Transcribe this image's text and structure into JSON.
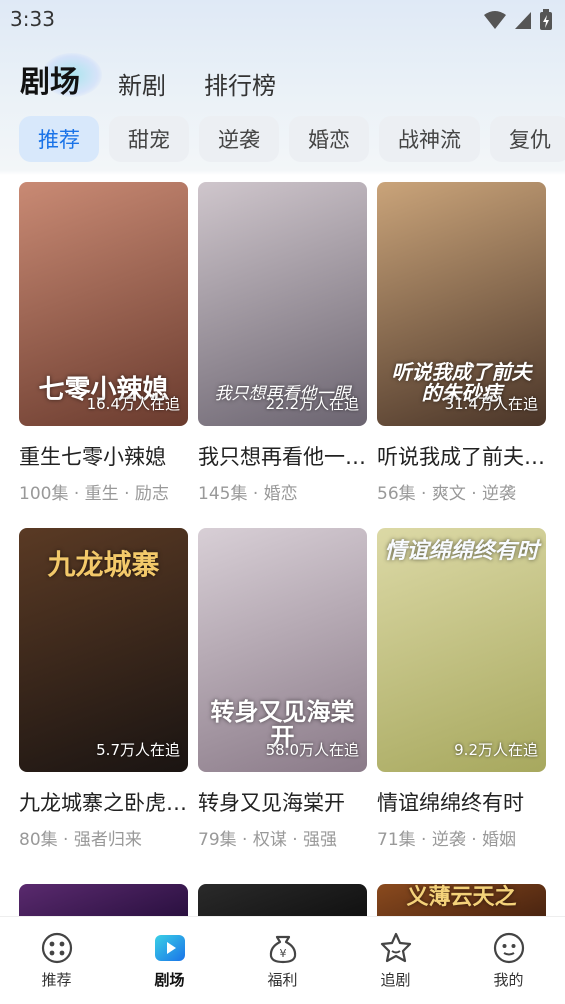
{
  "status_bar": {
    "time": "3:33"
  },
  "header": {
    "tabs": [
      {
        "label": "剧场",
        "active": true
      },
      {
        "label": "新剧",
        "active": false
      },
      {
        "label": "排行榜",
        "active": false
      }
    ]
  },
  "categories": [
    "推荐",
    "甜宠",
    "逆袭",
    "婚恋",
    "战神流",
    "复仇"
  ],
  "dramas": [
    {
      "title": "重生七零小辣媳",
      "poster_text": "七零小辣媳",
      "followers": "16.4万人在追",
      "meta": "100集 · 重生 · 励志",
      "colors": [
        "#c98a74",
        "#6a3b2e"
      ]
    },
    {
      "title": "我只想再看他一…",
      "poster_text": "我只想再看他一眼",
      "followers": "22.2万人在追",
      "meta": "145集 · 婚恋",
      "colors": [
        "#cfc6cc",
        "#6b6470"
      ]
    },
    {
      "title": "听说我成了前夫…",
      "poster_text": "听说我成了前夫的朱砂痣",
      "followers": "31.4万人在追",
      "meta": "56集 · 爽文 · 逆袭",
      "colors": [
        "#caa47a",
        "#4a3528"
      ]
    },
    {
      "title": "九龙城寨之卧虎…",
      "poster_text": "九龙城寨",
      "followers": "5.7万人在追",
      "meta": "80集 · 强者归来",
      "colors": [
        "#5a3a24",
        "#1a1412"
      ]
    },
    {
      "title": "转身又见海棠开",
      "poster_text": "转身又见海棠开",
      "followers": "58.0万人在追",
      "meta": "79集 · 权谋 · 强强",
      "colors": [
        "#d8cfd6",
        "#8a7a88"
      ]
    },
    {
      "title": "情谊绵绵终有时",
      "poster_text": "情谊绵绵终有时",
      "followers": "9.2万人在追",
      "meta": "71集 · 逆袭 · 婚姻",
      "colors": [
        "#dcd9a6",
        "#a7a85e"
      ]
    }
  ],
  "partial_row": [
    {
      "colors": [
        "#5a2a6e",
        "#2a1040"
      ]
    },
    {
      "colors": [
        "#2a2a2a",
        "#111111"
      ]
    },
    {
      "poster_text": "义薄云天之",
      "colors": [
        "#8a4a1e",
        "#4a2410"
      ]
    }
  ],
  "bottom_nav": [
    {
      "label": "推荐",
      "icon": "recommend-icon",
      "active": false
    },
    {
      "label": "剧场",
      "icon": "theater-play-icon",
      "active": true
    },
    {
      "label": "福利",
      "icon": "money-bag-icon",
      "active": false
    },
    {
      "label": "追剧",
      "icon": "star-icon",
      "active": false
    },
    {
      "label": "我的",
      "icon": "profile-face-icon",
      "active": false
    }
  ],
  "colors": {
    "accent": "#1a73e8",
    "active_chip_bg": "#d8e8fb",
    "chip_bg": "#eceff3"
  }
}
